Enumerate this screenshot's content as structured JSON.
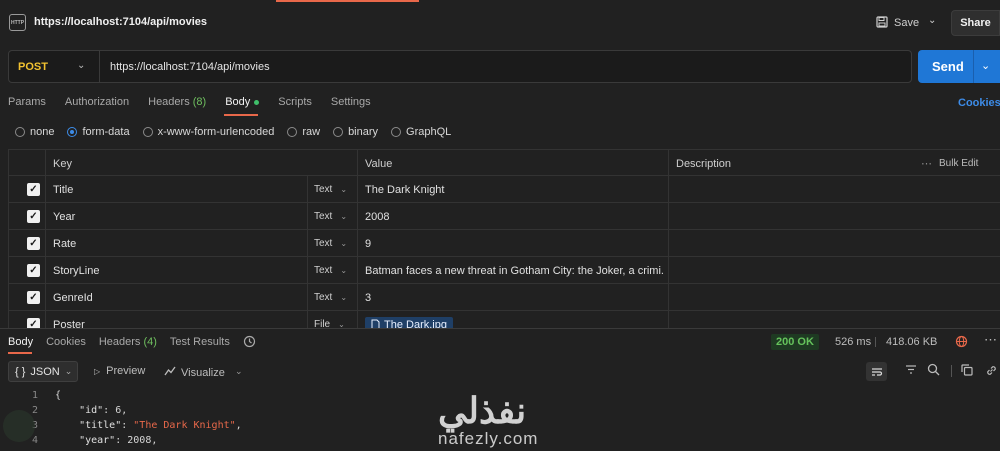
{
  "titlebar": {
    "http_icon": "HTTP",
    "title": "https://localhost:7104/api/movies",
    "save_label": "Save",
    "share_label": "Share"
  },
  "request": {
    "method": "POST",
    "url": "https://localhost:7104/api/movies",
    "send_label": "Send"
  },
  "tabs": [
    {
      "label": "Params"
    },
    {
      "label": "Authorization"
    },
    {
      "label": "Headers",
      "count": "(8)"
    },
    {
      "label": "Body",
      "active": true
    },
    {
      "label": "Scripts"
    },
    {
      "label": "Settings"
    }
  ],
  "cookies_label": "Cookies",
  "body_types": [
    {
      "label": "none",
      "selected": false
    },
    {
      "label": "form-data",
      "selected": true
    },
    {
      "label": "x-www-form-urlencoded",
      "selected": false
    },
    {
      "label": "raw",
      "selected": false
    },
    {
      "label": "binary",
      "selected": false
    },
    {
      "label": "GraphQL",
      "selected": false
    }
  ],
  "table": {
    "headers": {
      "key": "Key",
      "value": "Value",
      "description": "Description",
      "bulk_edit": "Bulk Edit"
    },
    "rows": [
      {
        "key": "Title",
        "type": "Text",
        "value": "The Dark Knight"
      },
      {
        "key": "Year",
        "type": "Text",
        "value": "2008"
      },
      {
        "key": "Rate",
        "type": "Text",
        "value": "9"
      },
      {
        "key": "StoryLine",
        "type": "Text",
        "value": "Batman faces a new threat in Gotham City: the Joker, a crimi..."
      },
      {
        "key": "GenreId",
        "type": "Text",
        "value": "3"
      },
      {
        "key": "Poster",
        "type": "File",
        "value": "The Dark.jpg"
      }
    ]
  },
  "response": {
    "tabs": [
      {
        "label": "Body",
        "active": true
      },
      {
        "label": "Cookies"
      },
      {
        "label": "Headers",
        "count": "(4)"
      },
      {
        "label": "Test Results"
      }
    ],
    "status": "200 OK",
    "time": "526 ms",
    "size": "418.06 KB",
    "format": "JSON",
    "format_icon": "{ }",
    "preview_label": "Preview",
    "visualize_label": "Visualize",
    "code_lines": [
      {
        "n": "1",
        "parts": [
          {
            "t": "{",
            "c": "p"
          }
        ]
      },
      {
        "n": "2",
        "parts": [
          {
            "t": "    \"id\"",
            "c": "key"
          },
          {
            "t": ": ",
            "c": "p"
          },
          {
            "t": "6",
            "c": "num"
          },
          {
            "t": ",",
            "c": "p"
          }
        ]
      },
      {
        "n": "3",
        "parts": [
          {
            "t": "    \"title\"",
            "c": "key"
          },
          {
            "t": ": ",
            "c": "p"
          },
          {
            "t": "\"The Dark Knight\"",
            "c": "str"
          },
          {
            "t": ",",
            "c": "p"
          }
        ]
      },
      {
        "n": "4",
        "parts": [
          {
            "t": "    \"year\"",
            "c": "key"
          },
          {
            "t": ": ",
            "c": "p"
          },
          {
            "t": "2008",
            "c": "num"
          },
          {
            "t": ",",
            "c": "p"
          }
        ]
      }
    ]
  },
  "watermark": {
    "arabic": "نفذلي",
    "latin": "nafezly.com"
  },
  "colors": {
    "accent": "#e8684a",
    "send": "#1f77d6",
    "method": "#f2c230",
    "status_ok": "#65c35c",
    "link": "#3d8ce8"
  }
}
